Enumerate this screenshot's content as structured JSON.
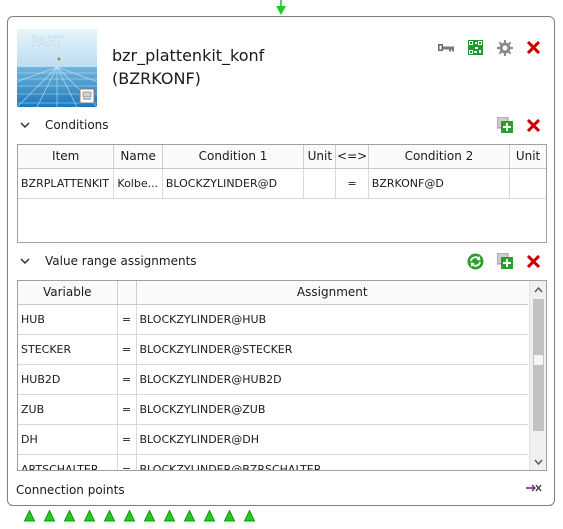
{
  "header": {
    "title_line1": "bzr_plattenkit_konf",
    "title_line2": "(BZRKONF)",
    "thumbnail_text": "PART",
    "icons": [
      "key-icon",
      "qr-code-icon",
      "gear-icon",
      "delete-icon"
    ]
  },
  "conditions": {
    "label": "Conditions",
    "columns": [
      "Item",
      "Name",
      "Condition 1",
      "Unit",
      "<=>",
      "Condition 2",
      "Unit"
    ],
    "rows": [
      [
        "BZRPLATTENKIT",
        "Kolbe...",
        "BLOCKZYLINDER@D",
        "",
        "=",
        "BZRKONF@D",
        ""
      ]
    ]
  },
  "value_range": {
    "label": "Value range assignments",
    "columns": [
      "Variable",
      "",
      "Assignment"
    ],
    "rows": [
      [
        "HUB",
        "=",
        "BLOCKZYLINDER@HUB"
      ],
      [
        "STECKER",
        "=",
        "BLOCKZYLINDER@STECKER"
      ],
      [
        "HUB2D",
        "=",
        "BLOCKZYLINDER@HUB2D"
      ],
      [
        "ZUB",
        "=",
        "BLOCKZYLINDER@ZUB"
      ],
      [
        "DH",
        "=",
        "BLOCKZYLINDER@DH"
      ],
      [
        "ARTSCHALTER",
        "=",
        "BLOCKZYLINDER@BZRSCHALTER"
      ]
    ]
  },
  "connection_points": {
    "label": "Connection points"
  },
  "colors": {
    "green": "#22bb22",
    "red": "#cc0000",
    "border": "#7f7f7f"
  }
}
